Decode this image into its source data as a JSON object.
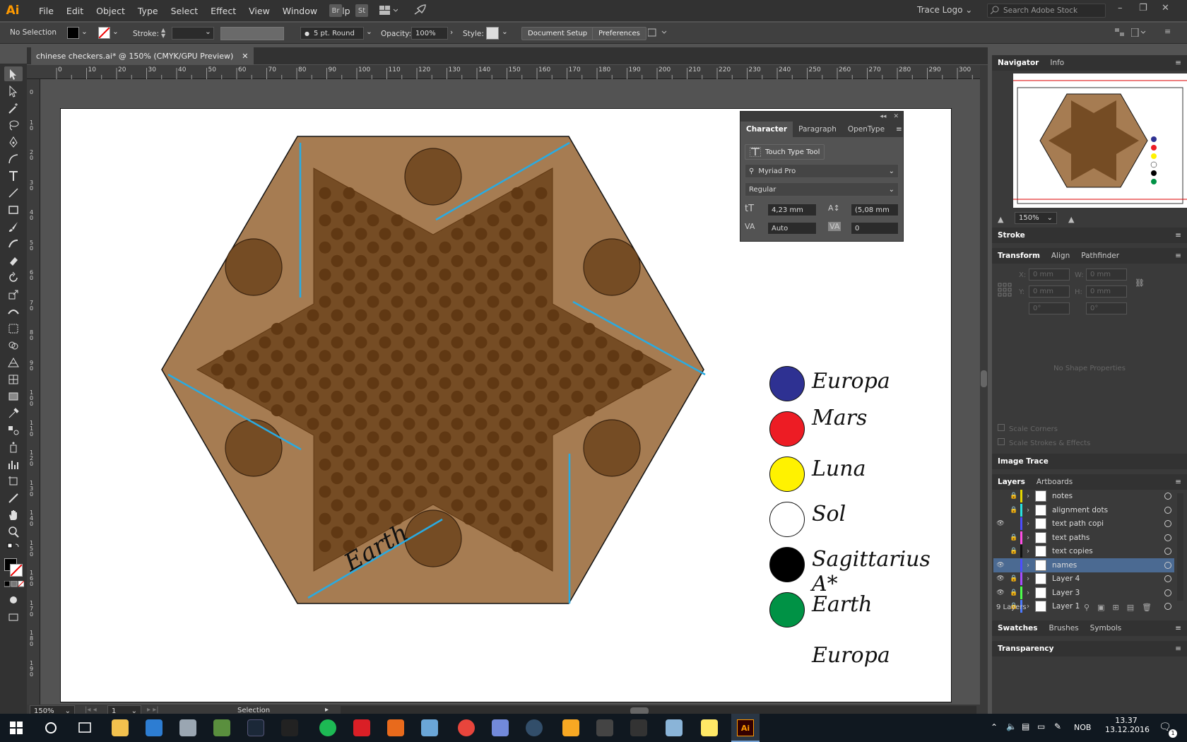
{
  "app": {
    "logo": "Ai"
  },
  "menu": [
    "File",
    "Edit",
    "Object",
    "Type",
    "Select",
    "Effect",
    "View",
    "Window",
    "Help"
  ],
  "menu_tools": {
    "br": "Br",
    "st": "St"
  },
  "workspace": "Trace Logo",
  "search": {
    "placeholder": "Search Adobe Stock"
  },
  "control": {
    "selection": "No Selection",
    "stroke_label": "Stroke:",
    "brush": "5 pt. Round",
    "opacity_label": "Opacity:",
    "opacity": "100%",
    "style_label": "Style:",
    "doc_setup": "Document Setup",
    "preferences": "Preferences"
  },
  "document": {
    "tab": "chinese checkers.ai* @ 150% (CMYK/GPU Preview)"
  },
  "ruler": {
    "h": [
      "0",
      "10",
      "20",
      "30",
      "40",
      "50",
      "60",
      "70",
      "80",
      "90",
      "100",
      "110",
      "120",
      "130",
      "140",
      "150",
      "160",
      "170",
      "180",
      "190",
      "200",
      "210",
      "220",
      "230",
      "240",
      "250",
      "260",
      "270",
      "280",
      "290",
      "300"
    ],
    "v": [
      "0",
      "1 0",
      "2 0",
      "3 0",
      "4 0",
      "5 0",
      "6 0",
      "7 0",
      "8 0",
      "9 0",
      "1 0 0",
      "1 1 0",
      "1 2 0",
      "1 3 0",
      "1 4 0",
      "1 5 0",
      "1 6 0",
      "1 7 0",
      "1 8 0",
      "1 9 0"
    ]
  },
  "artwork": {
    "earth_path_text": "Earth",
    "legend": [
      {
        "label": "Europa",
        "color": "#2e3192"
      },
      {
        "label": "Mars",
        "color": "#ed1c24"
      },
      {
        "label": "Luna",
        "color": "#fff200"
      },
      {
        "label": "Sol",
        "color": "#ffffff"
      },
      {
        "label": "Sagittarius A*",
        "color": "#000000"
      },
      {
        "label": "Earth",
        "color": "#009245"
      }
    ],
    "extra_label": "Europa",
    "colors": {
      "board": "#a67c52",
      "star": "#754c24",
      "hole": "#603813",
      "guide": "#29abe2"
    }
  },
  "character_panel": {
    "tabs": [
      "Character",
      "Paragraph",
      "OpenType"
    ],
    "touch_type": "Touch Type Tool",
    "font_family": "Myriad Pro",
    "font_style": "Regular",
    "size": "4,23 mm",
    "leading": "(5,08 mm",
    "kerning": "Auto",
    "tracking": "0"
  },
  "status": {
    "zoom": "150%",
    "artboard": "1",
    "tool": "Selection"
  },
  "navigator": {
    "tabs": [
      "Navigator",
      "Info"
    ],
    "zoom": "150%"
  },
  "stroke_panel": {
    "title": "Stroke"
  },
  "transform_panel": {
    "tabs": [
      "Transform",
      "Align",
      "Pathfinder"
    ],
    "x": "0 mm",
    "y": "0 mm",
    "w": "0 mm",
    "h": "0 mm",
    "angle": "0°",
    "shear": "0°",
    "x_label": "X:",
    "y_label": "Y:",
    "w_label": "W:",
    "h_label": "H:",
    "empty": "No Shape Properties",
    "scale_corners": "Scale Corners",
    "scale_strokes": "Scale Strokes & Effects"
  },
  "image_trace": {
    "title": "Image Trace"
  },
  "layers_panel": {
    "tabs": [
      "Layers",
      "Artboards"
    ],
    "layers": [
      {
        "name": "notes",
        "color": "#e6d800",
        "visible": false,
        "locked": true
      },
      {
        "name": "alignment dots",
        "color": "#29e2e2",
        "visible": false,
        "locked": true
      },
      {
        "name": "text path copi",
        "color": "#4d4dff",
        "visible": true,
        "locked": false
      },
      {
        "name": "text paths",
        "color": "#ff4de6",
        "visible": false,
        "locked": true
      },
      {
        "name": "text copies",
        "color": "#111111",
        "visible": false,
        "locked": true
      },
      {
        "name": "names",
        "color": "#4d4dff",
        "visible": true,
        "locked": false
      },
      {
        "name": "Layer 4",
        "color": "#a64dff",
        "visible": true,
        "locked": true
      },
      {
        "name": "Layer 3",
        "color": "#4dff4d",
        "visible": true,
        "locked": true
      },
      {
        "name": "Layer 1",
        "color": "#4d7aff",
        "visible": false,
        "locked": true
      }
    ],
    "count": "9 Layers"
  },
  "swatches_panel": {
    "tabs": [
      "Swatches",
      "Brushes",
      "Symbols"
    ]
  },
  "transparency_panel": {
    "title": "Transparency"
  },
  "taskbar": {
    "lang": "NOB",
    "time": "13.37",
    "date": "13.12.2016",
    "notif": "1"
  }
}
